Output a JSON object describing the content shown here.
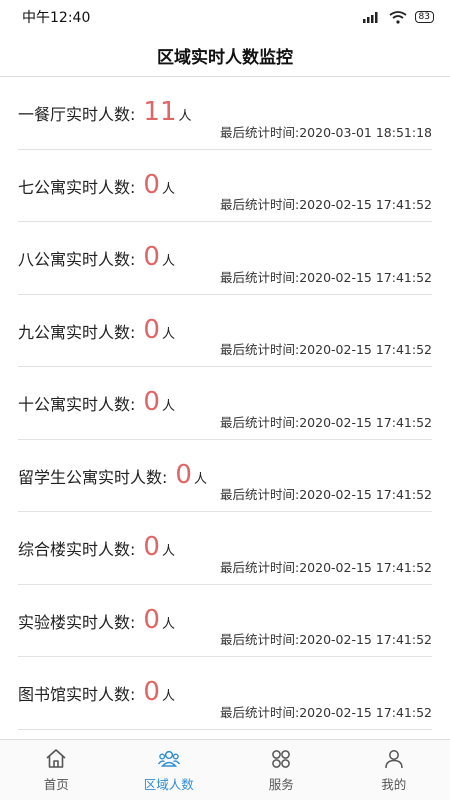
{
  "status": {
    "time": "中午12:40",
    "battery": "83"
  },
  "header": {
    "title": "区域实时人数监控"
  },
  "rows": [
    {
      "label": "一餐厅实时人数:",
      "count": "11",
      "unit": "人",
      "time": "最后统计时间:2020-03-01 18:51:18"
    },
    {
      "label": "七公寓实时人数:",
      "count": "0",
      "unit": "人",
      "time": "最后统计时间:2020-02-15 17:41:52"
    },
    {
      "label": "八公寓实时人数:",
      "count": "0",
      "unit": "人",
      "time": "最后统计时间:2020-02-15 17:41:52"
    },
    {
      "label": "九公寓实时人数:",
      "count": "0",
      "unit": "人",
      "time": "最后统计时间:2020-02-15 17:41:52"
    },
    {
      "label": "十公寓实时人数:",
      "count": "0",
      "unit": "人",
      "time": "最后统计时间:2020-02-15 17:41:52"
    },
    {
      "label": "留学生公寓实时人数:",
      "count": "0",
      "unit": "人",
      "time": "最后统计时间:2020-02-15 17:41:52"
    },
    {
      "label": "综合楼实时人数:",
      "count": "0",
      "unit": "人",
      "time": "最后统计时间:2020-02-15 17:41:52"
    },
    {
      "label": "实验楼实时人数:",
      "count": "0",
      "unit": "人",
      "time": "最后统计时间:2020-02-15 17:41:52"
    },
    {
      "label": "图书馆实时人数:",
      "count": "0",
      "unit": "人",
      "time": "最后统计时间:2020-02-15 17:41:52"
    }
  ],
  "tabs": [
    {
      "label": "首页",
      "icon": "home-icon"
    },
    {
      "label": "区域人数",
      "icon": "people-icon"
    },
    {
      "label": "服务",
      "icon": "services-icon"
    },
    {
      "label": "我的",
      "icon": "profile-icon"
    }
  ],
  "colors": {
    "accent": "#2f8fd8",
    "count": "#e06666"
  }
}
